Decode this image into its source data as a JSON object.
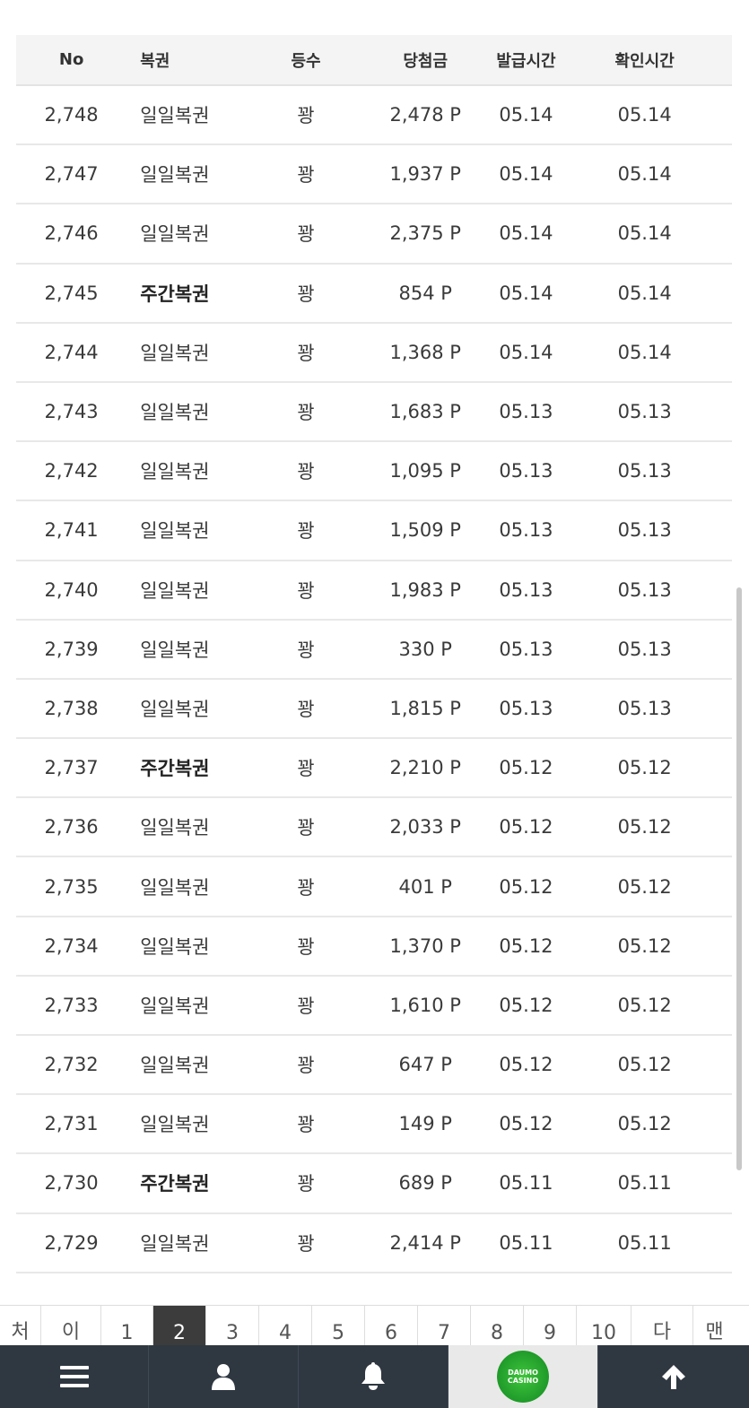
{
  "table": {
    "headers": {
      "no": "No",
      "type": "복권",
      "rank": "등수",
      "prize": "당첨금",
      "issued": "발급시간",
      "checked": "확인시간"
    },
    "rows": [
      {
        "no": "2,748",
        "type": "일일복권",
        "bold": false,
        "rank": "꽝",
        "prize": "2,478 P",
        "issued": "05.14",
        "checked": "05.14"
      },
      {
        "no": "2,747",
        "type": "일일복권",
        "bold": false,
        "rank": "꽝",
        "prize": "1,937 P",
        "issued": "05.14",
        "checked": "05.14"
      },
      {
        "no": "2,746",
        "type": "일일복권",
        "bold": false,
        "rank": "꽝",
        "prize": "2,375 P",
        "issued": "05.14",
        "checked": "05.14"
      },
      {
        "no": "2,745",
        "type": "주간복권",
        "bold": true,
        "rank": "꽝",
        "prize": "854 P",
        "issued": "05.14",
        "checked": "05.14"
      },
      {
        "no": "2,744",
        "type": "일일복권",
        "bold": false,
        "rank": "꽝",
        "prize": "1,368 P",
        "issued": "05.14",
        "checked": "05.14"
      },
      {
        "no": "2,743",
        "type": "일일복권",
        "bold": false,
        "rank": "꽝",
        "prize": "1,683 P",
        "issued": "05.13",
        "checked": "05.13"
      },
      {
        "no": "2,742",
        "type": "일일복권",
        "bold": false,
        "rank": "꽝",
        "prize": "1,095 P",
        "issued": "05.13",
        "checked": "05.13"
      },
      {
        "no": "2,741",
        "type": "일일복권",
        "bold": false,
        "rank": "꽝",
        "prize": "1,509 P",
        "issued": "05.13",
        "checked": "05.13"
      },
      {
        "no": "2,740",
        "type": "일일복권",
        "bold": false,
        "rank": "꽝",
        "prize": "1,983 P",
        "issued": "05.13",
        "checked": "05.13"
      },
      {
        "no": "2,739",
        "type": "일일복권",
        "bold": false,
        "rank": "꽝",
        "prize": "330 P",
        "issued": "05.13",
        "checked": "05.13"
      },
      {
        "no": "2,738",
        "type": "일일복권",
        "bold": false,
        "rank": "꽝",
        "prize": "1,815 P",
        "issued": "05.13",
        "checked": "05.13"
      },
      {
        "no": "2,737",
        "type": "주간복권",
        "bold": true,
        "rank": "꽝",
        "prize": "2,210 P",
        "issued": "05.12",
        "checked": "05.12"
      },
      {
        "no": "2,736",
        "type": "일일복권",
        "bold": false,
        "rank": "꽝",
        "prize": "2,033 P",
        "issued": "05.12",
        "checked": "05.12"
      },
      {
        "no": "2,735",
        "type": "일일복권",
        "bold": false,
        "rank": "꽝",
        "prize": "401 P",
        "issued": "05.12",
        "checked": "05.12"
      },
      {
        "no": "2,734",
        "type": "일일복권",
        "bold": false,
        "rank": "꽝",
        "prize": "1,370 P",
        "issued": "05.12",
        "checked": "05.12"
      },
      {
        "no": "2,733",
        "type": "일일복권",
        "bold": false,
        "rank": "꽝",
        "prize": "1,610 P",
        "issued": "05.12",
        "checked": "05.12"
      },
      {
        "no": "2,732",
        "type": "일일복권",
        "bold": false,
        "rank": "꽝",
        "prize": "647 P",
        "issued": "05.12",
        "checked": "05.12"
      },
      {
        "no": "2,731",
        "type": "일일복권",
        "bold": false,
        "rank": "꽝",
        "prize": "149 P",
        "issued": "05.12",
        "checked": "05.12"
      },
      {
        "no": "2,730",
        "type": "주간복권",
        "bold": true,
        "rank": "꽝",
        "prize": "689 P",
        "issued": "05.11",
        "checked": "05.11"
      },
      {
        "no": "2,729",
        "type": "일일복권",
        "bold": false,
        "rank": "꽝",
        "prize": "2,414 P",
        "issued": "05.11",
        "checked": "05.11"
      }
    ]
  },
  "pagination": {
    "first": "처",
    "prev": "이",
    "pages": [
      "1",
      "2",
      "3",
      "4",
      "5",
      "6",
      "7",
      "8",
      "9",
      "10"
    ],
    "current": "2",
    "next": "다",
    "last": "맨"
  },
  "bottom_nav": {
    "logo_text_top": "DAUMO",
    "logo_text_bottom": "CASINO",
    "icons": [
      "menu-icon",
      "user-icon",
      "bell-icon",
      "logo",
      "arrow-up-icon"
    ]
  },
  "colors": {
    "nav_bg": "#2f3841",
    "active_page": "#3c3c3c",
    "logo_green": "#2b9b37"
  }
}
